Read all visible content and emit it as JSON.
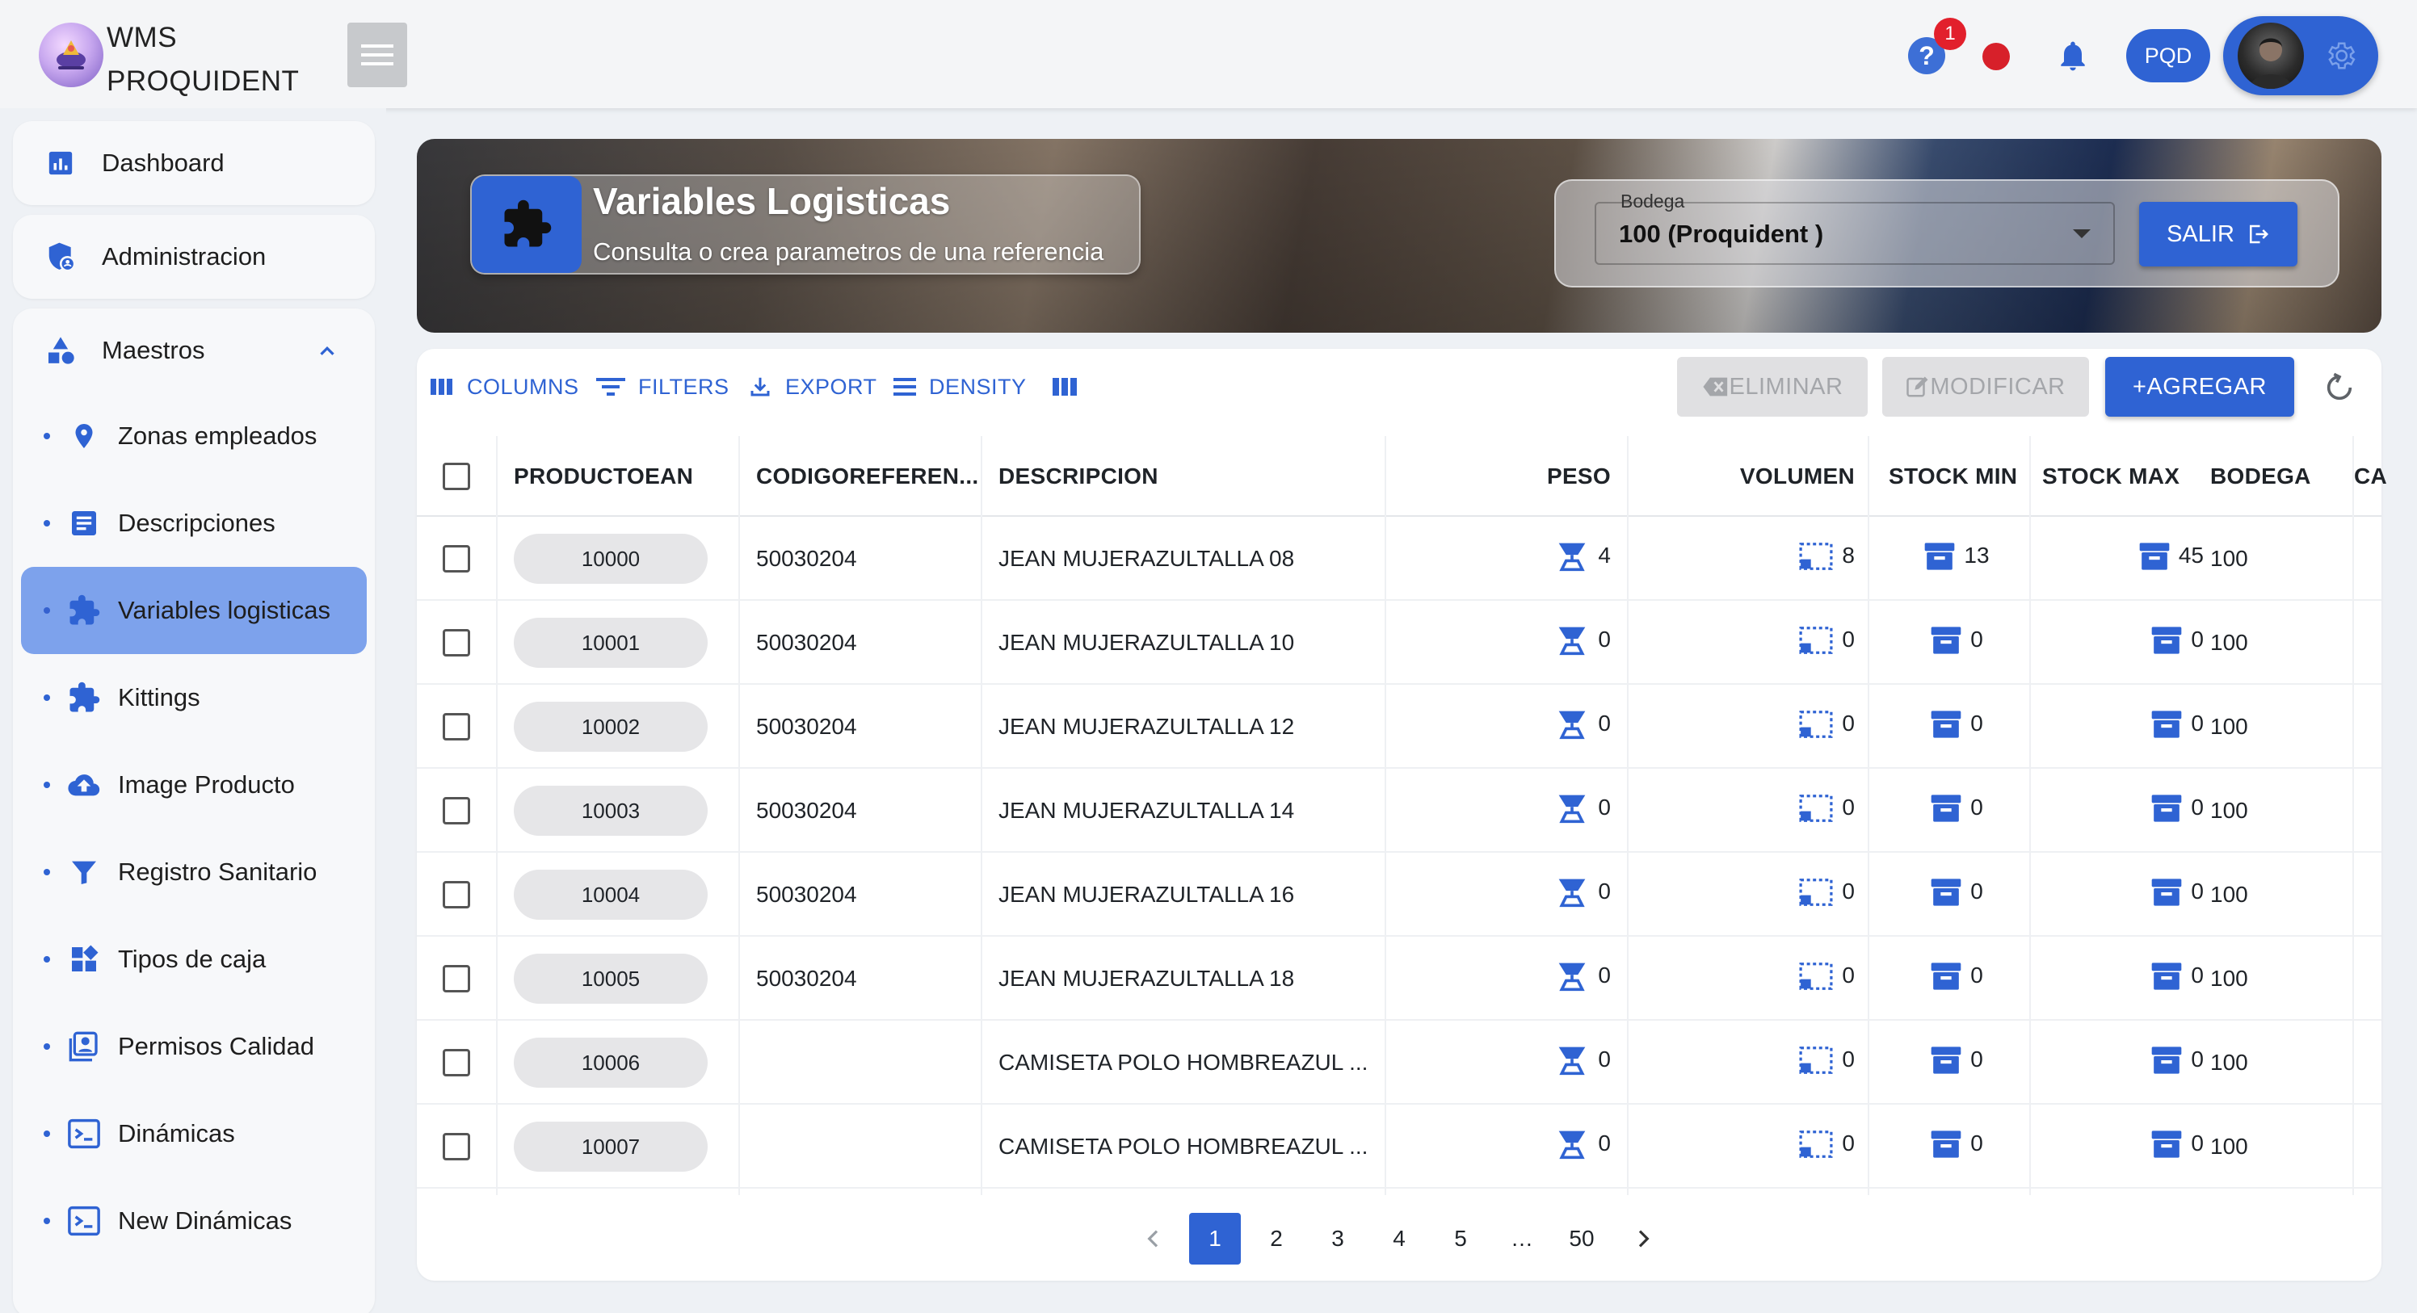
{
  "app": {
    "brand_line1": "WMS",
    "brand_line2": "PROQUIDENT",
    "help_badge": "1",
    "user_initials": "PQD"
  },
  "sidebar": {
    "dashboard": "Dashboard",
    "administracion": "Administracion",
    "maestros": "Maestros",
    "items": [
      {
        "label": "Zonas empleados",
        "icon": "location-pin-icon"
      },
      {
        "label": "Descripciones",
        "icon": "description-icon"
      },
      {
        "label": "Variables logisticas",
        "icon": "puzzle-icon"
      },
      {
        "label": "Kittings",
        "icon": "puzzle-icon"
      },
      {
        "label": "Image Producto",
        "icon": "cloud-upload-icon"
      },
      {
        "label": "Registro Sanitario",
        "icon": "filter-icon"
      },
      {
        "label": "Tipos de caja",
        "icon": "widgets-icon"
      },
      {
        "label": "Permisos Calidad",
        "icon": "portrait-icon"
      },
      {
        "label": "Dinámicas",
        "icon": "terminal-icon"
      },
      {
        "label": "New Dinámicas",
        "icon": "terminal-icon"
      }
    ]
  },
  "header": {
    "title": "Variables Logisticas",
    "subtitle": "Consulta o crea parametros de una referencia",
    "bodega_label": "Bodega",
    "bodega_value": "100 (Proquident )",
    "salir_label": "SALIR"
  },
  "toolbar": {
    "columns": "COLUMNS",
    "filters": "FILTERS",
    "export": "EXPORT",
    "density": "DENSITY",
    "eliminar": "ELIMINAR",
    "modificar": "MODIFICAR",
    "agregar": "+AGREGAR"
  },
  "table": {
    "columns": [
      "PRODUCTOEAN",
      "CODIGOREFEREN...",
      "DESCRIPCION",
      "PESO",
      "VOLUMEN",
      "STOCK MIN",
      "STOCK MAX",
      "BODEGA",
      "CA"
    ],
    "rows": [
      {
        "ean": "10000",
        "ref": "50030204",
        "desc": "JEAN MUJERAZULTALLA 08",
        "peso": "4",
        "volumen": "8",
        "stock_min": "13",
        "stock_max": "45",
        "bodega": "100"
      },
      {
        "ean": "10001",
        "ref": "50030204",
        "desc": "JEAN MUJERAZULTALLA 10",
        "peso": "0",
        "volumen": "0",
        "stock_min": "0",
        "stock_max": "0",
        "bodega": "100"
      },
      {
        "ean": "10002",
        "ref": "50030204",
        "desc": "JEAN MUJERAZULTALLA 12",
        "peso": "0",
        "volumen": "0",
        "stock_min": "0",
        "stock_max": "0",
        "bodega": "100"
      },
      {
        "ean": "10003",
        "ref": "50030204",
        "desc": "JEAN MUJERAZULTALLA 14",
        "peso": "0",
        "volumen": "0",
        "stock_min": "0",
        "stock_max": "0",
        "bodega": "100"
      },
      {
        "ean": "10004",
        "ref": "50030204",
        "desc": "JEAN MUJERAZULTALLA 16",
        "peso": "0",
        "volumen": "0",
        "stock_min": "0",
        "stock_max": "0",
        "bodega": "100"
      },
      {
        "ean": "10005",
        "ref": "50030204",
        "desc": "JEAN MUJERAZULTALLA 18",
        "peso": "0",
        "volumen": "0",
        "stock_min": "0",
        "stock_max": "0",
        "bodega": "100"
      },
      {
        "ean": "10006",
        "ref": "",
        "desc": "CAMISETA POLO HOMBREAZUL ...",
        "peso": "0",
        "volumen": "0",
        "stock_min": "0",
        "stock_max": "0",
        "bodega": "100"
      },
      {
        "ean": "10007",
        "ref": "",
        "desc": "CAMISETA POLO HOMBREAZUL ...",
        "peso": "0",
        "volumen": "0",
        "stock_min": "0",
        "stock_max": "0",
        "bodega": "100"
      }
    ]
  },
  "pagination": {
    "pages": [
      "1",
      "2",
      "3",
      "4",
      "5",
      "…",
      "50"
    ],
    "current": "1"
  },
  "colors": {
    "primary": "#2f63d3",
    "active_nav": "#7da2ec",
    "badge": "#e2202c"
  }
}
